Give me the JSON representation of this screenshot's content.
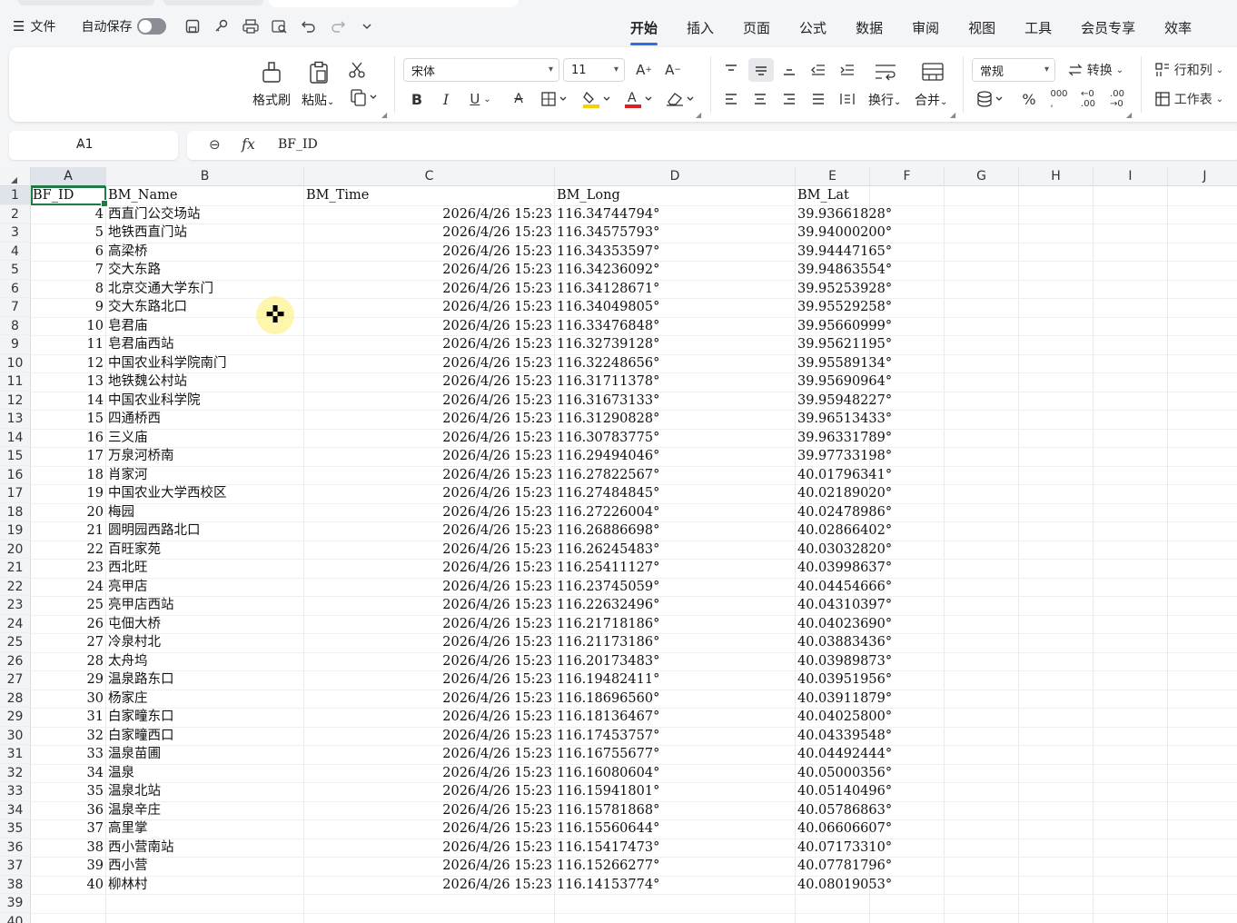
{
  "menubar": {
    "menu_label": "文件",
    "autosave_label": "自动保存",
    "tabs": [
      "开始",
      "插入",
      "页面",
      "公式",
      "数据",
      "审阅",
      "视图",
      "工具",
      "会员专享",
      "效率"
    ]
  },
  "ribbon": {
    "format_painter": "格式刷",
    "paste": "粘贴",
    "font_name": "宋体",
    "font_size": "11",
    "wrap": "换行",
    "merge": "合并",
    "number_format": "常规",
    "convert": "转换",
    "row_col": "行和列",
    "worksheet": "工作表",
    "bold": "B",
    "italic": "I",
    "underline": "U",
    "percent": "%"
  },
  "formula_bar": {
    "name_box": "A1",
    "fx": "fx",
    "value": "BF_ID"
  },
  "sheet": {
    "columns": [
      "A",
      "B",
      "C",
      "D",
      "E",
      "F",
      "G",
      "H",
      "I",
      "J"
    ],
    "headers": {
      "a": "BF_ID",
      "b": "BM_Name",
      "c": "BM_Time",
      "d": "BM_Long",
      "e": "BM_Lat"
    },
    "row_numbers": [
      "1",
      "2",
      "3",
      "4",
      "5",
      "6",
      "7",
      "8",
      "9",
      "10",
      "11",
      "12",
      "13",
      "14",
      "15",
      "16",
      "17",
      "18",
      "19",
      "20",
      "21",
      "22",
      "23",
      "24",
      "25",
      "26",
      "27",
      "28",
      "29",
      "30",
      "31",
      "32",
      "33",
      "34",
      "35",
      "36",
      "37",
      "38",
      "39",
      "40"
    ],
    "rows": [
      {
        "id": "4",
        "name": "西直门公交场站",
        "time": "2026/4/26 15:23",
        "long": "116.34744794°",
        "lat": "39.93661828°"
      },
      {
        "id": "5",
        "name": "地铁西直门站",
        "time": "2026/4/26 15:23",
        "long": "116.34575793°",
        "lat": "39.94000200°"
      },
      {
        "id": "6",
        "name": "高梁桥",
        "time": "2026/4/26 15:23",
        "long": "116.34353597°",
        "lat": "39.94447165°"
      },
      {
        "id": "7",
        "name": "交大东路",
        "time": "2026/4/26 15:23",
        "long": "116.34236092°",
        "lat": "39.94863554°"
      },
      {
        "id": "8",
        "name": "北京交通大学东门",
        "time": "2026/4/26 15:23",
        "long": "116.34128671°",
        "lat": "39.95253928°"
      },
      {
        "id": "9",
        "name": "交大东路北口",
        "time": "2026/4/26 15:23",
        "long": "116.34049805°",
        "lat": "39.95529258°"
      },
      {
        "id": "10",
        "name": "皂君庙",
        "time": "2026/4/26 15:23",
        "long": "116.33476848°",
        "lat": "39.95660999°"
      },
      {
        "id": "11",
        "name": "皂君庙西站",
        "time": "2026/4/26 15:23",
        "long": "116.32739128°",
        "lat": "39.95621195°"
      },
      {
        "id": "12",
        "name": "中国农业科学院南门",
        "time": "2026/4/26 15:23",
        "long": "116.32248656°",
        "lat": "39.95589134°"
      },
      {
        "id": "13",
        "name": "地铁魏公村站",
        "time": "2026/4/26 15:23",
        "long": "116.31711378°",
        "lat": "39.95690964°"
      },
      {
        "id": "14",
        "name": "中国农业科学院",
        "time": "2026/4/26 15:23",
        "long": "116.31673133°",
        "lat": "39.95948227°"
      },
      {
        "id": "15",
        "name": "四通桥西",
        "time": "2026/4/26 15:23",
        "long": "116.31290828°",
        "lat": "39.96513433°"
      },
      {
        "id": "16",
        "name": "三义庙",
        "time": "2026/4/26 15:23",
        "long": "116.30783775°",
        "lat": "39.96331789°"
      },
      {
        "id": "17",
        "name": "万泉河桥南",
        "time": "2026/4/26 15:23",
        "long": "116.29494046°",
        "lat": "39.97733198°"
      },
      {
        "id": "18",
        "name": "肖家河",
        "time": "2026/4/26 15:23",
        "long": "116.27822567°",
        "lat": "40.01796341°"
      },
      {
        "id": "19",
        "name": "中国农业大学西校区",
        "time": "2026/4/26 15:23",
        "long": "116.27484845°",
        "lat": "40.02189020°"
      },
      {
        "id": "20",
        "name": "梅园",
        "time": "2026/4/26 15:23",
        "long": "116.27226004°",
        "lat": "40.02478986°"
      },
      {
        "id": "21",
        "name": "圆明园西路北口",
        "time": "2026/4/26 15:23",
        "long": "116.26886698°",
        "lat": "40.02866402°"
      },
      {
        "id": "22",
        "name": "百旺家苑",
        "time": "2026/4/26 15:23",
        "long": "116.26245483°",
        "lat": "40.03032820°"
      },
      {
        "id": "23",
        "name": "西北旺",
        "time": "2026/4/26 15:23",
        "long": "116.25411127°",
        "lat": "40.03998637°"
      },
      {
        "id": "24",
        "name": "亮甲店",
        "time": "2026/4/26 15:23",
        "long": "116.23745059°",
        "lat": "40.04454666°"
      },
      {
        "id": "25",
        "name": "亮甲店西站",
        "time": "2026/4/26 15:23",
        "long": "116.22632496°",
        "lat": "40.04310397°"
      },
      {
        "id": "26",
        "name": "屯佃大桥",
        "time": "2026/4/26 15:23",
        "long": "116.21718186°",
        "lat": "40.04023690°"
      },
      {
        "id": "27",
        "name": "冷泉村北",
        "time": "2026/4/26 15:23",
        "long": "116.21173186°",
        "lat": "40.03883436°"
      },
      {
        "id": "28",
        "name": "太舟坞",
        "time": "2026/4/26 15:23",
        "long": "116.20173483°",
        "lat": "40.03989873°"
      },
      {
        "id": "29",
        "name": "温泉路东口",
        "time": "2026/4/26 15:23",
        "long": "116.19482411°",
        "lat": "40.03951956°"
      },
      {
        "id": "30",
        "name": "杨家庄",
        "time": "2026/4/26 15:23",
        "long": "116.18696560°",
        "lat": "40.03911879°"
      },
      {
        "id": "31",
        "name": "白家疃东口",
        "time": "2026/4/26 15:23",
        "long": "116.18136467°",
        "lat": "40.04025800°"
      },
      {
        "id": "32",
        "name": "白家疃西口",
        "time": "2026/4/26 15:23",
        "long": "116.17453757°",
        "lat": "40.04339548°"
      },
      {
        "id": "33",
        "name": "温泉苗圃",
        "time": "2026/4/26 15:23",
        "long": "116.16755677°",
        "lat": "40.04492444°"
      },
      {
        "id": "34",
        "name": "温泉",
        "time": "2026/4/26 15:23",
        "long": "116.16080604°",
        "lat": "40.05000356°"
      },
      {
        "id": "35",
        "name": "温泉北站",
        "time": "2026/4/26 15:23",
        "long": "116.15941801°",
        "lat": "40.05140496°"
      },
      {
        "id": "36",
        "name": "温泉辛庄",
        "time": "2026/4/26 15:23",
        "long": "116.15781868°",
        "lat": "40.05786863°"
      },
      {
        "id": "37",
        "name": "高里掌",
        "time": "2026/4/26 15:23",
        "long": "116.15560644°",
        "lat": "40.06606607°"
      },
      {
        "id": "38",
        "name": "西小营南站",
        "time": "2026/4/26 15:23",
        "long": "116.15417473°",
        "lat": "40.07173310°"
      },
      {
        "id": "39",
        "name": "西小营",
        "time": "2026/4/26 15:23",
        "long": "116.15266277°",
        "lat": "40.07781796°"
      },
      {
        "id": "40",
        "name": "柳林村",
        "time": "2026/4/26 15:23",
        "long": "116.14153774°",
        "lat": "40.08019053°"
      }
    ]
  }
}
